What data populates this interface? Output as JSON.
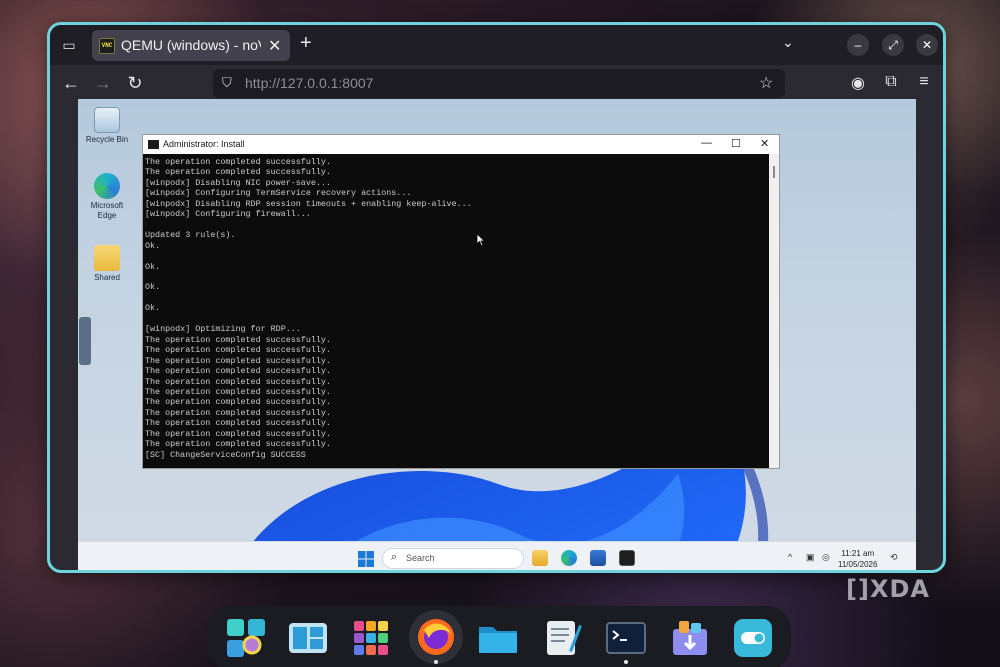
{
  "browser": {
    "tab": {
      "title": "QEMU (windows) - noVNC",
      "icon_text": "VNC",
      "close_glyph": "✕"
    },
    "new_tab_glyph": "+",
    "url": "http://127.0.0.1:8007",
    "accent_color": "#6fd3de"
  },
  "desktop": {
    "icons": [
      {
        "label": "Recycle Bin",
        "icon": "recycle-bin-icon"
      },
      {
        "label": "Microsoft Edge",
        "icon": "edge-icon"
      },
      {
        "label": "Shared",
        "icon": "folder-icon"
      }
    ]
  },
  "cmd": {
    "title": "Administrator: Install",
    "lines": [
      "The operation completed successfully.",
      "The operation completed successfully.",
      "[winpodx] Disabling NIC power-save...",
      "[winpodx] Configuring TermService recovery actions...",
      "[winpodx] Disabling RDP session timeouts + enabling keep-alive...",
      "[winpodx] Configuring firewall...",
      "",
      "Updated 3 rule(s).",
      "Ok.",
      "",
      "Ok.",
      "",
      "Ok.",
      "",
      "Ok.",
      "",
      "[winpodx] Optimizing for RDP...",
      "The operation completed successfully.",
      "The operation completed successfully.",
      "The operation completed successfully.",
      "The operation completed successfully.",
      "The operation completed successfully.",
      "The operation completed successfully.",
      "The operation completed successfully.",
      "The operation completed successfully.",
      "The operation completed successfully.",
      "The operation completed successfully.",
      "The operation completed successfully.",
      "[SC] ChangeServiceConfig SUCCESS"
    ]
  },
  "taskbar": {
    "search_placeholder": "Search",
    "time": "11:21 am",
    "date": "11/05/2026"
  },
  "watermark": "XDA",
  "dock": {
    "apps": [
      {
        "icon": "search-app-icon",
        "running": false
      },
      {
        "icon": "window-manager-icon",
        "running": false
      },
      {
        "icon": "app-grid-icon",
        "running": false
      },
      {
        "icon": "firefox-icon",
        "running": true
      },
      {
        "icon": "files-icon",
        "running": false
      },
      {
        "icon": "text-editor-icon",
        "running": false
      },
      {
        "icon": "terminal-icon",
        "running": true
      },
      {
        "icon": "software-install-icon",
        "running": false
      },
      {
        "icon": "toggle-settings-icon",
        "running": false
      }
    ]
  }
}
